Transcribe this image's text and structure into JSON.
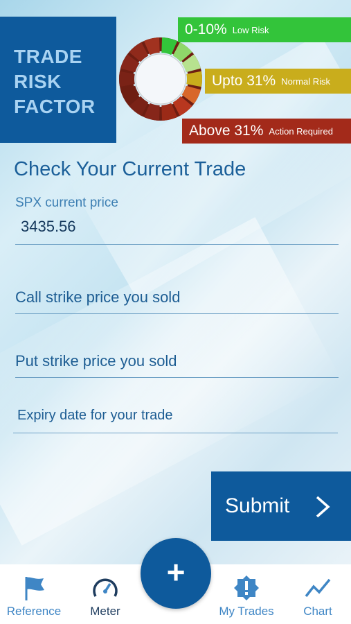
{
  "header": {
    "logo_lines": [
      "TRADE",
      "RISK",
      "FACTOR"
    ],
    "risk_levels": [
      {
        "range": "0-10%",
        "label": "Low Risk",
        "color": "#33c43a"
      },
      {
        "range": "Upto 31%",
        "label": "Normal Risk",
        "color": "#c9ad1c"
      },
      {
        "range": "Above 31%",
        "label": "Action Required",
        "color": "#a32a1a"
      }
    ]
  },
  "form": {
    "title": "Check Your Current Trade",
    "spx": {
      "label": "SPX current price",
      "value": "3435.56"
    },
    "call_strike_placeholder": "Call strike price you sold",
    "put_strike_placeholder": "Put strike price you sold",
    "expiry_placeholder": "Expiry date for your trade",
    "submit_label": "Submit"
  },
  "nav": {
    "items": [
      {
        "label": "Reference",
        "icon": "flag-icon"
      },
      {
        "label": "Meter",
        "icon": "speedometer-icon"
      },
      {
        "label": "My Trades",
        "icon": "alert-badge-icon"
      },
      {
        "label": "Chart",
        "icon": "line-chart-icon"
      }
    ],
    "fab_icon": "plus-icon",
    "fab_symbol": "+"
  },
  "colors": {
    "primary": "#0e5a9c",
    "nav_accent": "#3f86c5"
  }
}
